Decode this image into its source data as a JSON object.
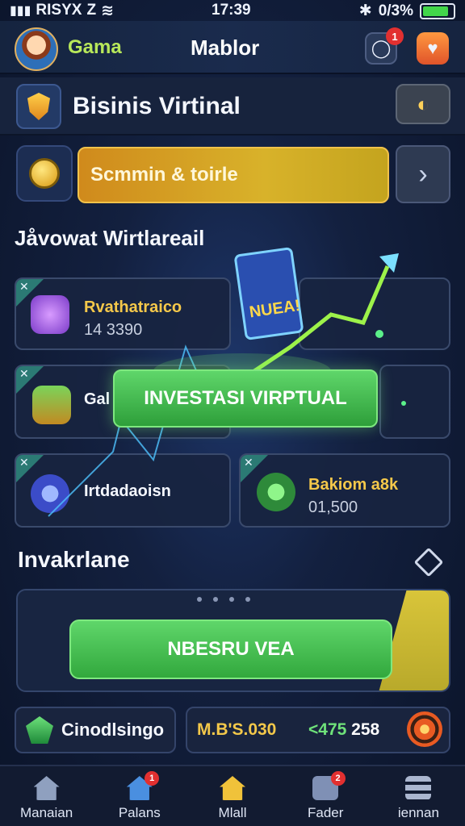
{
  "status_bar": {
    "carrier": "RISYX",
    "carrier_extra": "Z",
    "time": "17:39",
    "battery_text": "0/3%",
    "battery_level": 0.85
  },
  "header": {
    "app_name": "Gama",
    "title": "Mablor",
    "notification_count": "1"
  },
  "section": {
    "title": "Bisinis Virtinal"
  },
  "search": {
    "value": "Scmmin & toirle"
  },
  "list_heading": "Jåvowat Wirtlareail",
  "cards": [
    {
      "title": "Rvathatraico",
      "value": "14 3390",
      "icon": "speaker-icon"
    },
    {
      "title": "Gal",
      "value": "",
      "icon": "box-icon"
    },
    {
      "title": "Irtdadaoisn",
      "value": "",
      "icon": "planet-icon"
    },
    {
      "title": "Bakiom a8k",
      "value": "01,500",
      "icon": "gear-icon"
    }
  ],
  "billboard_text": "NUEA!",
  "invest_button": "INVESTASI VIRPTUAL",
  "sub_heading": "Invakrlane",
  "promo_button": "NBESRU VEA",
  "bottom_row": {
    "label": "Cinodlsingo",
    "stat_a": "M.B'S.030",
    "stat_b_prefix": "<475",
    "stat_b_suffix": " 258"
  },
  "nav": [
    {
      "label": "Manaian",
      "icon": "home-icon",
      "badge": ""
    },
    {
      "label": "Palans",
      "icon": "house-alert-icon",
      "badge": "1"
    },
    {
      "label": "Mlall",
      "icon": "shop-icon",
      "badge": ""
    },
    {
      "label": "Fader",
      "icon": "mail-icon",
      "badge": "2"
    },
    {
      "label": "iennan",
      "icon": "menu-icon",
      "badge": ""
    }
  ],
  "colors": {
    "accent_green": "#4ccf5c",
    "accent_gold": "#d8b22a",
    "background": "#13203f"
  }
}
